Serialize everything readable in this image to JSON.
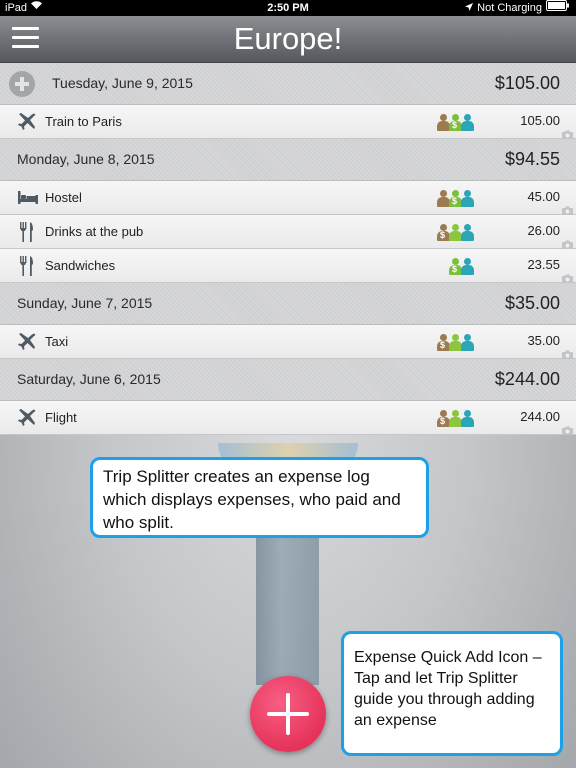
{
  "status_bar": {
    "device": "iPad",
    "time": "2:50 PM",
    "charging": "Not Charging"
  },
  "header": {
    "title": "Europe!"
  },
  "colors": {
    "payer": "#9b7b4f",
    "payer_dollar": "#7bbf3a",
    "split_green": "#8cc63f",
    "split_teal": "#2aa6b8",
    "callout_border": "#1ea0e6",
    "fab": "#ee4a70"
  },
  "days": [
    {
      "date": "Tuesday, June 9, 2015",
      "total": "$105.00",
      "show_add": true,
      "expenses": [
        {
          "name": "Train to Paris",
          "amount": "105.00",
          "icon": "airplane-icon",
          "people": [
            "brown",
            "green-payer",
            "teal"
          ]
        }
      ]
    },
    {
      "date": "Monday, June 8, 2015",
      "total": "$94.55",
      "show_add": false,
      "expenses": [
        {
          "name": "Hostel",
          "amount": "45.00",
          "icon": "bed-icon",
          "people": [
            "brown",
            "green-payer",
            "teal"
          ]
        },
        {
          "name": "Drinks at the pub",
          "amount": "26.00",
          "icon": "fork-knife-icon",
          "people": [
            "brown-payer",
            "green",
            "teal"
          ]
        },
        {
          "name": "Sandwiches",
          "amount": "23.55",
          "icon": "fork-knife-icon",
          "people": [
            "green-payer",
            "teal"
          ]
        }
      ]
    },
    {
      "date": "Sunday, June 7, 2015",
      "total": "$35.00",
      "show_add": false,
      "expenses": [
        {
          "name": "Taxi",
          "amount": "35.00",
          "icon": "airplane-icon",
          "people": [
            "brown-payer",
            "green",
            "teal"
          ]
        }
      ]
    },
    {
      "date": "Saturday, June 6, 2015",
      "total": "$244.00",
      "show_add": false,
      "expenses": [
        {
          "name": "Flight",
          "amount": "244.00",
          "icon": "airplane-icon",
          "people": [
            "brown-payer",
            "green",
            "teal"
          ]
        }
      ]
    }
  ],
  "callouts": {
    "log": "Trip Splitter creates an expense log which displays expenses, who paid and who split.",
    "quick_add": "Expense Quick Add Icon – Tap and let Trip Splitter guide you through adding an expense"
  }
}
